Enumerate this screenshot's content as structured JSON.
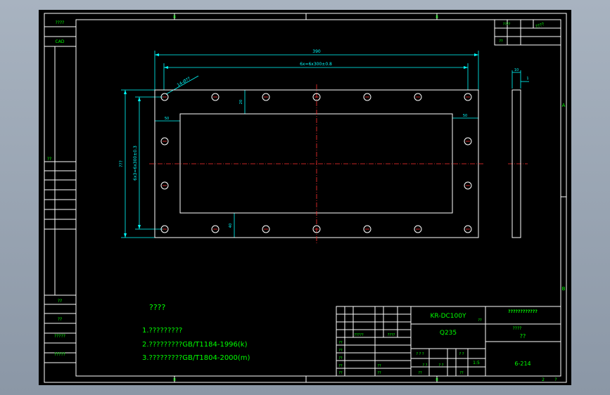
{
  "colors": {
    "background": "#a8b3c0",
    "sheet": "#000000",
    "frame": "#ffffff",
    "dimension": "#00ffff",
    "centerline": "#ff0000",
    "text": "#00ff00",
    "holes": "#ff0000"
  },
  "frame_markers": {
    "top": [
      "8",
      "8"
    ],
    "bottom": [
      "8",
      "8",
      "2",
      "?"
    ],
    "right": [
      "A",
      "B"
    ]
  },
  "left_strip": {
    "labels": [
      "????",
      "CAD",
      "??",
      "??",
      "??",
      "?????",
      "?????"
    ]
  },
  "drawing": {
    "dim_overall_width": "390",
    "dim_hole_pitch": "6x=6x300±0.8",
    "dim_hole_dia": "14-Ø??",
    "dim_height": "???",
    "dim_hole_vertical": "6x3=6x300±0.3",
    "dim_margin_top": "20",
    "dim_margin_left": "50",
    "dim_margin_right": "50",
    "dim_margin_bottom": "40",
    "side_dim_width": "10",
    "side_dim_gap": "1"
  },
  "notes": {
    "title": "????",
    "lines": [
      "1.?????????",
      "2.?????????GB/T1184-1996(k)",
      "3.?????????GB/T1804-2000(m)"
    ]
  },
  "top_right_block": {
    "row1_a": "????",
    "row1_b": "????",
    "row2_a": "??"
  },
  "title_block": {
    "drawing_code": "KR-DC100Y",
    "company_short": "??",
    "company": "????????????",
    "material": "Q235",
    "part_name": "????",
    "part_name2": "??",
    "scale": "1:5",
    "sheet_no": "6-214",
    "col_labels": [
      "??",
      "??",
      "??",
      "??",
      "??"
    ],
    "row_labels": [
      "??",
      "??",
      "??",
      "??"
    ],
    "mid_cells": [
      "?????",
      "????",
      "? ? ?",
      "? ?",
      "? ?",
      "? ?"
    ]
  }
}
